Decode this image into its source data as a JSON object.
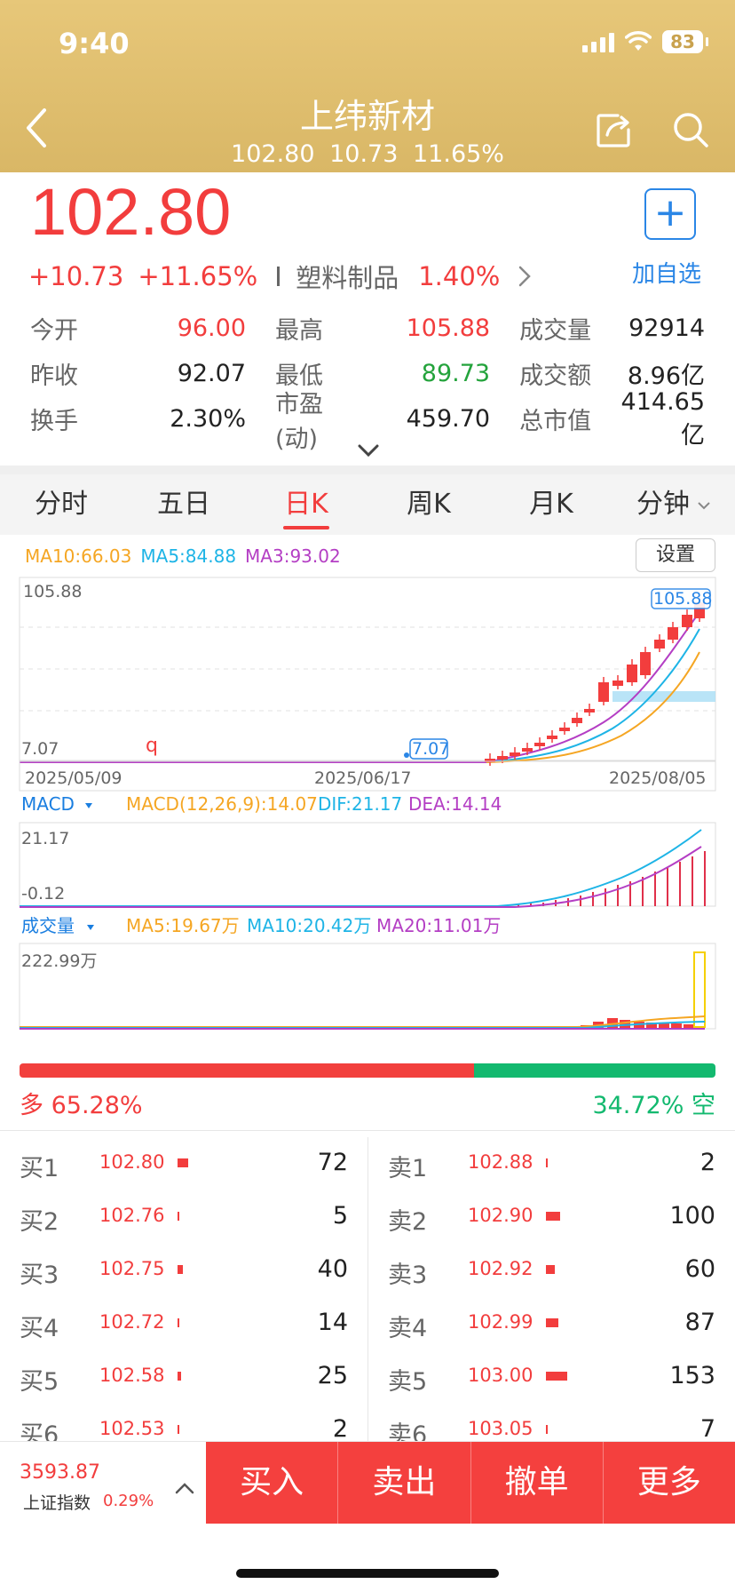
{
  "status": {
    "time": "9:40",
    "battery": "83"
  },
  "header": {
    "title": "上纬新材",
    "price": "102.80",
    "change": "10.73",
    "change_pct": "11.65%"
  },
  "quote": {
    "price": "102.80",
    "change": "+10.73",
    "change_pct": "+11.65%",
    "sector": "塑料制品",
    "sector_pct": "1.40%",
    "add_label": "加自选",
    "stats": [
      [
        {
          "label": "今开",
          "value": "96.00",
          "color": "red"
        },
        {
          "label": "最高",
          "value": "105.88",
          "color": "red"
        },
        {
          "label": "成交量",
          "value": "92914",
          "color": "black"
        }
      ],
      [
        {
          "label": "昨收",
          "value": "92.07",
          "color": "black"
        },
        {
          "label": "最低",
          "value": "89.73",
          "color": "green"
        },
        {
          "label": "成交额",
          "value": "8.96亿",
          "color": "black"
        }
      ],
      [
        {
          "label": "换手",
          "value": "2.30%",
          "color": "black"
        },
        {
          "label": "市盈(动)",
          "value": "459.70",
          "color": "black"
        },
        {
          "label": "总市值",
          "value": "414.65亿",
          "color": "black"
        }
      ]
    ]
  },
  "tabs": [
    "分时",
    "五日",
    "日K",
    "周K",
    "月K",
    "分钟"
  ],
  "active_tab": "日K",
  "kline": {
    "ma10": "MA10:66.03",
    "ma5": "MA5:84.88",
    "ma3": "MA3:93.02",
    "settings_label": "设置",
    "high_label": "105.88",
    "low_label": "7.07",
    "high_marker": "105.88",
    "low_marker": "7.07",
    "q_marker": "q",
    "dates": [
      "2025/05/09",
      "2025/06/17",
      "2025/08/05"
    ]
  },
  "macd": {
    "title": "MACD",
    "value": "MACD(12,26,9):14.07",
    "dif": "DIF:21.17",
    "dea": "DEA:14.14",
    "top_label": "21.17",
    "bottom_label": "-0.12"
  },
  "volume": {
    "title": "成交量",
    "ma5": "MA5:19.67万",
    "ma10": "MA10:20.42万",
    "ma20": "MA20:11.01万",
    "top_label": "222.99万"
  },
  "long_short": {
    "long_label": "多 65.28%",
    "short_label": "34.72% 空",
    "long_pct": 65.28
  },
  "order_book": {
    "buy": [
      {
        "label": "买1",
        "price": "102.80",
        "vol": "72",
        "bar": 72
      },
      {
        "label": "买2",
        "price": "102.76",
        "vol": "5",
        "bar": 5
      },
      {
        "label": "买3",
        "price": "102.75",
        "vol": "40",
        "bar": 40
      },
      {
        "label": "买4",
        "price": "102.72",
        "vol": "14",
        "bar": 14
      },
      {
        "label": "买5",
        "price": "102.58",
        "vol": "25",
        "bar": 25
      },
      {
        "label": "买6",
        "price": "102.53",
        "vol": "2",
        "bar": 2
      }
    ],
    "sell": [
      {
        "label": "卖1",
        "price": "102.88",
        "vol": "2",
        "bar": 2
      },
      {
        "label": "卖2",
        "price": "102.90",
        "vol": "100",
        "bar": 100
      },
      {
        "label": "卖3",
        "price": "102.92",
        "vol": "60",
        "bar": 60
      },
      {
        "label": "卖4",
        "price": "102.99",
        "vol": "87",
        "bar": 87
      },
      {
        "label": "卖5",
        "price": "103.00",
        "vol": "153",
        "bar": 153
      },
      {
        "label": "卖6",
        "price": "103.05",
        "vol": "7",
        "bar": 7
      }
    ]
  },
  "bottom_bar": {
    "index_value": "3593.87",
    "index_name": "上证指数",
    "index_pct": "0.29%",
    "actions": [
      "买入",
      "卖出",
      "撤单",
      "更多"
    ]
  },
  "colors": {
    "up": "#f23d3d",
    "down": "#24a33c",
    "header": "#ddb96a",
    "accent": "#2a86e6"
  }
}
